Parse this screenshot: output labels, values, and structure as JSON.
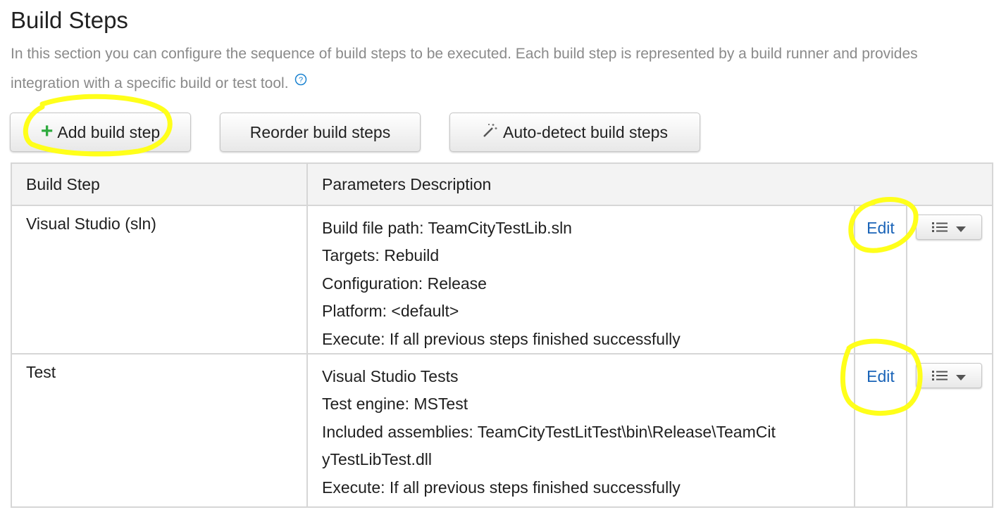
{
  "header": {
    "title": "Build Steps",
    "description": "In this section you can configure the sequence of build steps to be executed. Each build step is represented by a build runner and provides integration with a specific build or test tool."
  },
  "toolbar": {
    "add_label": "Add build step",
    "reorder_label": "Reorder build steps",
    "autodetect_label": "Auto-detect build steps"
  },
  "table": {
    "columns": [
      "Build Step",
      "Parameters Description"
    ],
    "rows": [
      {
        "name": "Visual Studio (sln)",
        "params": [
          "Build file path: TeamCityTestLib.sln",
          "Targets: Rebuild",
          "Configuration: Release",
          "Platform: <default>",
          "Execute: If all previous steps finished successfully"
        ],
        "edit_label": "Edit"
      },
      {
        "name": "Test",
        "params": [
          "Visual Studio Tests",
          "Test engine: MSTest",
          "Included assemblies: TeamCityTestLitTest\\bin\\Release\\TeamCit",
          "yTestLibTest.dll",
          "Execute: If all previous steps finished successfully"
        ],
        "edit_label": "Edit"
      }
    ]
  },
  "colors": {
    "highlight": "#ffff1a",
    "link": "#1a64b8",
    "add_icon": "#2eaa3e"
  },
  "icons": [
    "plus-icon",
    "help-icon",
    "magic-wand-icon",
    "list-icon",
    "caret-down-icon"
  ]
}
